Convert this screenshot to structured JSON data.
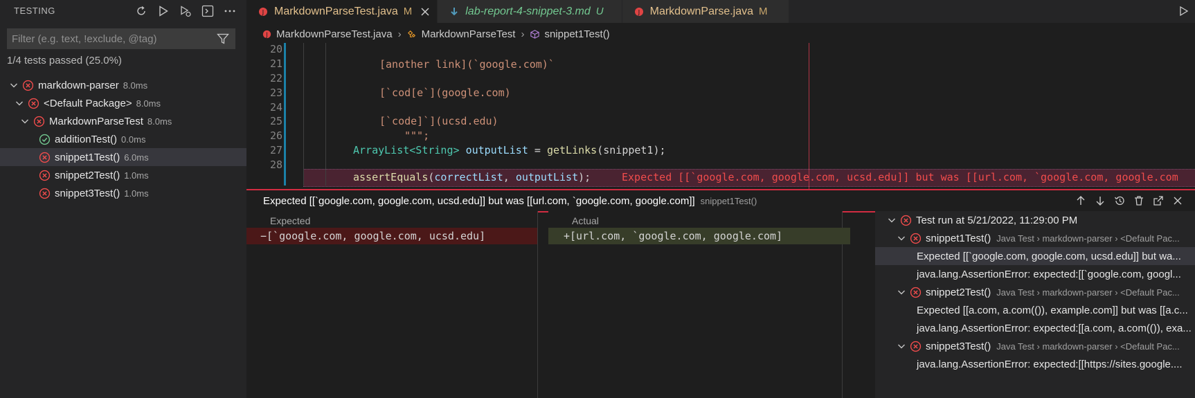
{
  "sidebar": {
    "title": "TESTING",
    "filter_placeholder": "Filter (e.g. text, !exclude, @tag)",
    "summary": "1/4 tests passed (25.0%)",
    "tree": [
      {
        "label": "markdown-parser",
        "duration": "8.0ms",
        "status": "failed"
      },
      {
        "label": "<Default Package>",
        "duration": "8.0ms",
        "status": "failed"
      },
      {
        "label": "MarkdownParseTest",
        "duration": "8.0ms",
        "status": "failed"
      },
      {
        "label": "additionTest()",
        "duration": "0.0ms",
        "status": "passed"
      },
      {
        "label": "snippet1Test()",
        "duration": "6.0ms",
        "status": "failed"
      },
      {
        "label": "snippet2Test()",
        "duration": "1.0ms",
        "status": "failed"
      },
      {
        "label": "snippet3Test()",
        "duration": "1.0ms",
        "status": "failed"
      }
    ]
  },
  "tabs": [
    {
      "label": "MarkdownParseTest.java",
      "status": "M"
    },
    {
      "label": "lab-report-4-snippet-3.md",
      "status": "U"
    },
    {
      "label": "MarkdownParse.java",
      "status": "M"
    }
  ],
  "breadcrumb": [
    "MarkdownParseTest.java",
    "MarkdownParseTest",
    "snippet1Test()"
  ],
  "code": {
    "line_numbers": [
      "20",
      "21",
      "22",
      "23",
      "24",
      "25",
      "26",
      "27",
      "28"
    ],
    "l21": "[another link](`google.com)`",
    "l23": "[`cod[e`](google.com)",
    "l25": "[`code]`](ucsd.edu)",
    "l26": "\"\"\";",
    "l27_type": "ArrayList",
    "l27_generic": "<String>",
    "l27_var": "outputList",
    "l27_eq": " = ",
    "l27_fn": "getLinks",
    "l27_arg": "(snippet1);",
    "l28_fn": "assertEquals",
    "l28_open": "(",
    "l28_a1": "correctList",
    "l28_comma": ", ",
    "l28_a2": "outputList",
    "l28_close": ");",
    "l28_error": "Expected [[`google.com, google.com, ucsd.edu]] but was [[url.com, `google.com, google.com"
  },
  "peek": {
    "title": "Expected [[`google.com, google.com, ucsd.edu]] but was [[url.com, `google.com, google.com]]",
    "test": "snippet1Test()",
    "expected_label": "Expected",
    "actual_label": "Actual",
    "expected_value": "−[`google.com, google.com, ucsd.edu]",
    "actual_value": "+[url.com, `google.com, google.com]"
  },
  "results": {
    "run": "Test run at 5/21/2022, 11:29:00 PM",
    "items": [
      {
        "name": "snippet1Test()",
        "meta": "Java Test › markdown-parser › <Default Pac...",
        "messages": [
          "Expected [[`google.com, google.com, ucsd.edu]] but wa...",
          "java.lang.AssertionError: expected:[[`google.com, googl..."
        ]
      },
      {
        "name": "snippet2Test()",
        "meta": "Java Test › markdown-parser › <Default Pac...",
        "messages": [
          "Expected [[a.com, a.com(()), example.com]] but was [[a.c...",
          "java.lang.AssertionError: expected:[[a.com, a.com(()), exa..."
        ]
      },
      {
        "name": "snippet3Test()",
        "meta": "Java Test › markdown-parser › <Default Pac...",
        "messages": [
          "java.lang.AssertionError: expected:[[https://sites.google...."
        ]
      }
    ]
  },
  "colors": {
    "error": "#f14c4c",
    "pass": "#73c991",
    "accent": "#d22c41"
  }
}
